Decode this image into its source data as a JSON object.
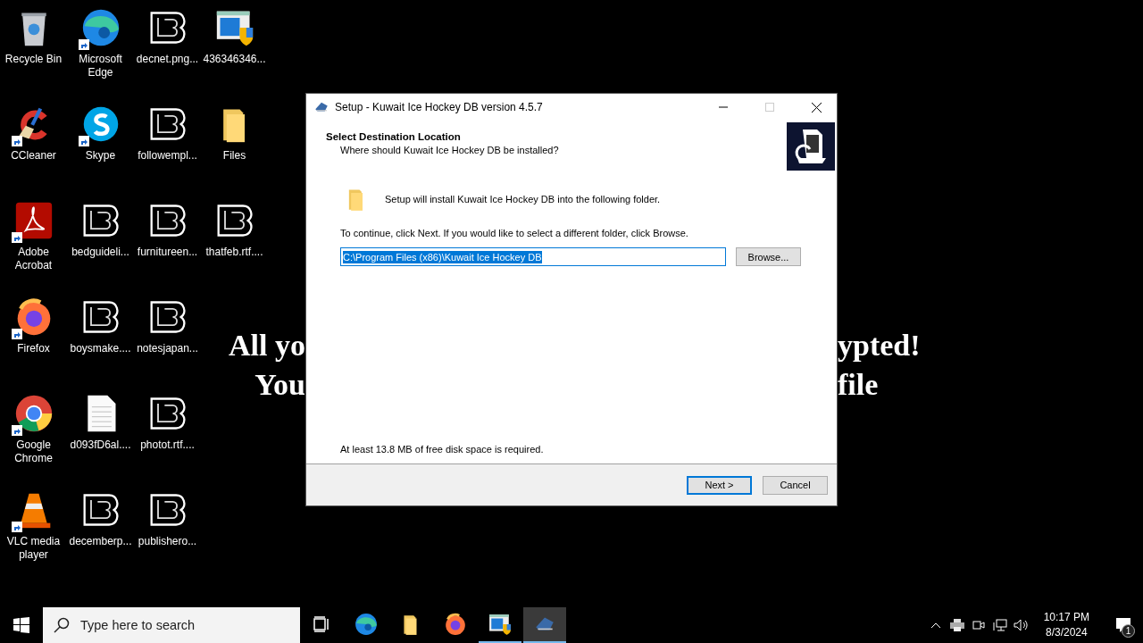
{
  "desktop_icons": [
    {
      "label": "Recycle Bin",
      "kind": "recycle",
      "shortcut": false
    },
    {
      "label": "CCleaner",
      "kind": "brush",
      "shortcut": true
    },
    {
      "label": "Adobe Acrobat",
      "kind": "pdf",
      "shortcut": true
    },
    {
      "label": "Firefox",
      "kind": "fox",
      "shortcut": true
    },
    {
      "label": "Google Chrome",
      "kind": "chrome",
      "shortcut": true
    },
    {
      "label": "VLC media player",
      "kind": "cone",
      "shortcut": true
    },
    {
      "label": "Microsoft Edge",
      "kind": "edge",
      "shortcut": true
    },
    {
      "label": "Skype",
      "kind": "chat",
      "shortcut": true
    },
    {
      "label": "bedguideli...",
      "kind": "lb",
      "shortcut": false
    },
    {
      "label": "boysmake....",
      "kind": "lb",
      "shortcut": false
    },
    {
      "label": "d093fD6al....",
      "kind": "doc",
      "shortcut": false
    },
    {
      "label": "decemberp...",
      "kind": "lb",
      "shortcut": false
    },
    {
      "label": "decnet.png...",
      "kind": "lb",
      "shortcut": false
    },
    {
      "label": "followempl...",
      "kind": "lb",
      "shortcut": false
    },
    {
      "label": "furnitureen...",
      "kind": "lb",
      "shortcut": false
    },
    {
      "label": "notesjapan...",
      "kind": "lb",
      "shortcut": false
    },
    {
      "label": "photot.rtf....",
      "kind": "lb",
      "shortcut": false
    },
    {
      "label": "publishero...",
      "kind": "lb",
      "shortcut": false
    },
    {
      "label": "436346346...",
      "kind": "installer",
      "shortcut": false
    },
    {
      "label": "Files",
      "kind": "folder",
      "shortcut": false
    },
    {
      "label": "thatfeb.rtf....",
      "kind": "lb",
      "shortcut": false
    }
  ],
  "wallpaper_text": [
    {
      "left": "All yo",
      "right": "ypted!"
    },
    {
      "left": "You",
      "right": "file"
    }
  ],
  "window": {
    "title": "Setup - Kuwait Ice Hockey DB version 4.5.7",
    "heading": "Select Destination Location",
    "subheading": "Where should Kuwait Ice Hockey DB be installed?",
    "folder_note": "Setup will install Kuwait Ice Hockey DB into the following folder.",
    "instruction": "To continue, click Next. If you would like to select a different folder, click Browse.",
    "path": {
      "value": "C:\\Program Files (x86)\\Kuwait Ice Hockey DB",
      "selected": true
    },
    "browse_button": "Browse...",
    "disk_note": "At least 13.8 MB of free disk space is required.",
    "buttons": [
      {
        "label": "Next >",
        "default": true
      },
      {
        "label": "Cancel",
        "default": false
      }
    ]
  },
  "taskbar": {
    "search": {
      "placeholder": "Type here to search"
    },
    "apps": [
      {
        "kind": "edge",
        "running": false,
        "active": false
      },
      {
        "kind": "folder",
        "running": false,
        "active": false
      },
      {
        "kind": "fox",
        "running": false,
        "active": false
      },
      {
        "kind": "installer",
        "running": true,
        "active": false
      },
      {
        "kind": "setup",
        "running": true,
        "active": true
      }
    ],
    "time": "10:17 PM",
    "date": "8/3/2024",
    "notification_count": "1"
  }
}
